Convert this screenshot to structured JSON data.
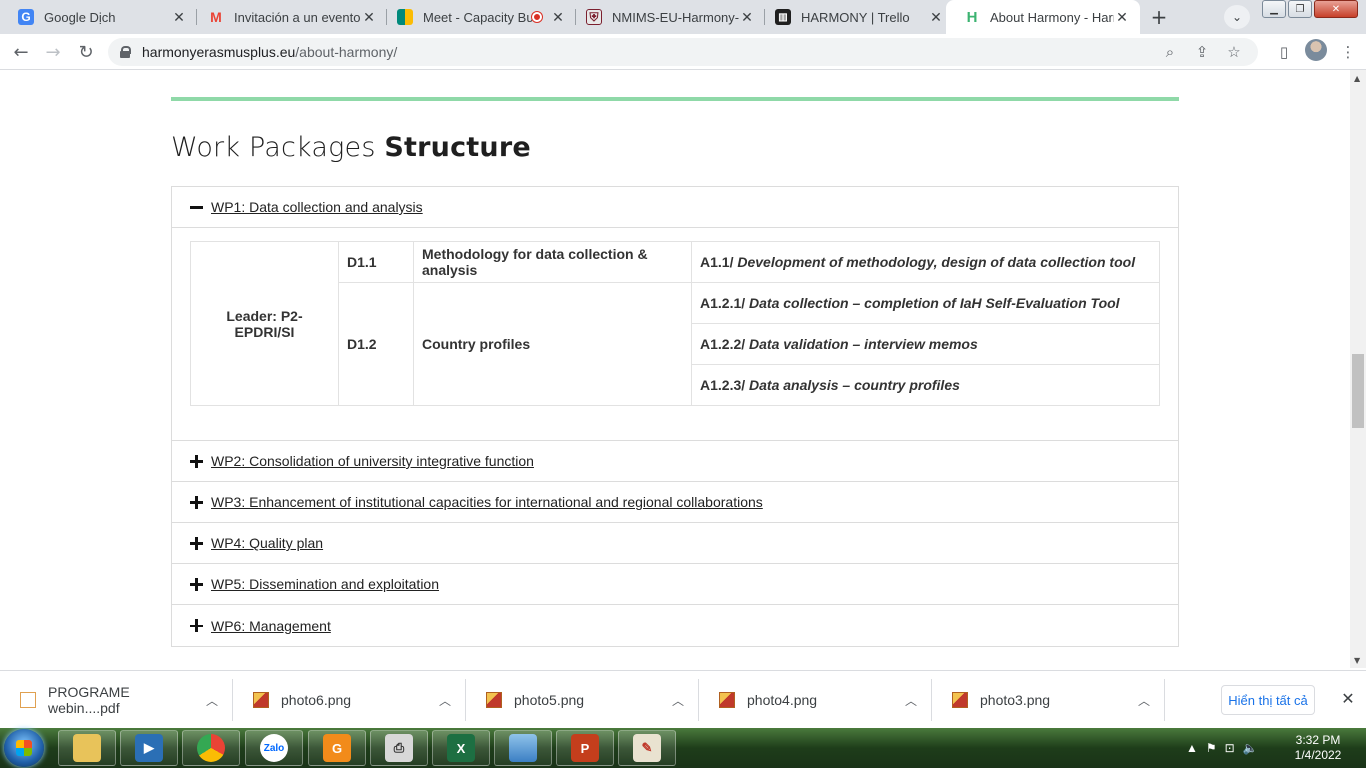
{
  "tabs": [
    {
      "label": "Google Dịch",
      "icon": "google-translate-icon",
      "color": "#4285f4"
    },
    {
      "label": "Invitación a un evento:",
      "icon": "gmail-icon",
      "color": "#ea4335"
    },
    {
      "label": "Meet - Capacity Bu",
      "icon": "google-meet-icon",
      "color": "#00897b"
    },
    {
      "label": "NMIMS-EU-Harmony-C",
      "icon": "shield-icon",
      "color": "#7b1f2e"
    },
    {
      "label": "HARMONY | Trello",
      "icon": "trello-icon",
      "color": "#0079bf"
    },
    {
      "label": "About Harmony - Harm",
      "icon": "harmony-icon",
      "color": "#3cb371"
    }
  ],
  "address_bar": {
    "host": "harmonyerasmusplus.eu",
    "path": "/about-harmony/"
  },
  "page": {
    "heading_light": "Work Packages ",
    "heading_bold": "Structure",
    "wp1": {
      "title": "WP1: Data collection and analysis",
      "leader": "Leader: P2-EPDRI/SI",
      "d11_code": "D1.1",
      "d11_title": "Methodology for data collection & analysis",
      "a11_code": "A1.1/",
      "a11_text": " Development of methodology, design of data collection tool",
      "d12_code": "D1.2",
      "d12_title": "Country profiles",
      "a121_code": "A1.2.1/",
      "a121_text": " Data collection – completion of IaH Self-Evaluation Tool",
      "a122_code": "A1.2.2/",
      "a122_text": " Data validation – interview memos",
      "a123_code": "A1.2.3/",
      "a123_text": " Data analysis – country profiles"
    },
    "wp_collapsed": [
      "WP2: Consolidation of university integrative function",
      "WP3: Enhancement of institutional capacities for international and regional collaborations",
      "WP4: Quality plan",
      "WP5: Dissemination and exploitation",
      "WP6: Management"
    ]
  },
  "downloads": {
    "items": [
      "PROGRAME webin....pdf",
      "photo6.png",
      "photo5.png",
      "photo4.png",
      "photo3.png"
    ],
    "show_all": "Hiển thị tất cả"
  },
  "taskbar": {
    "time": "3:32 PM",
    "date": "1/4/2022"
  }
}
